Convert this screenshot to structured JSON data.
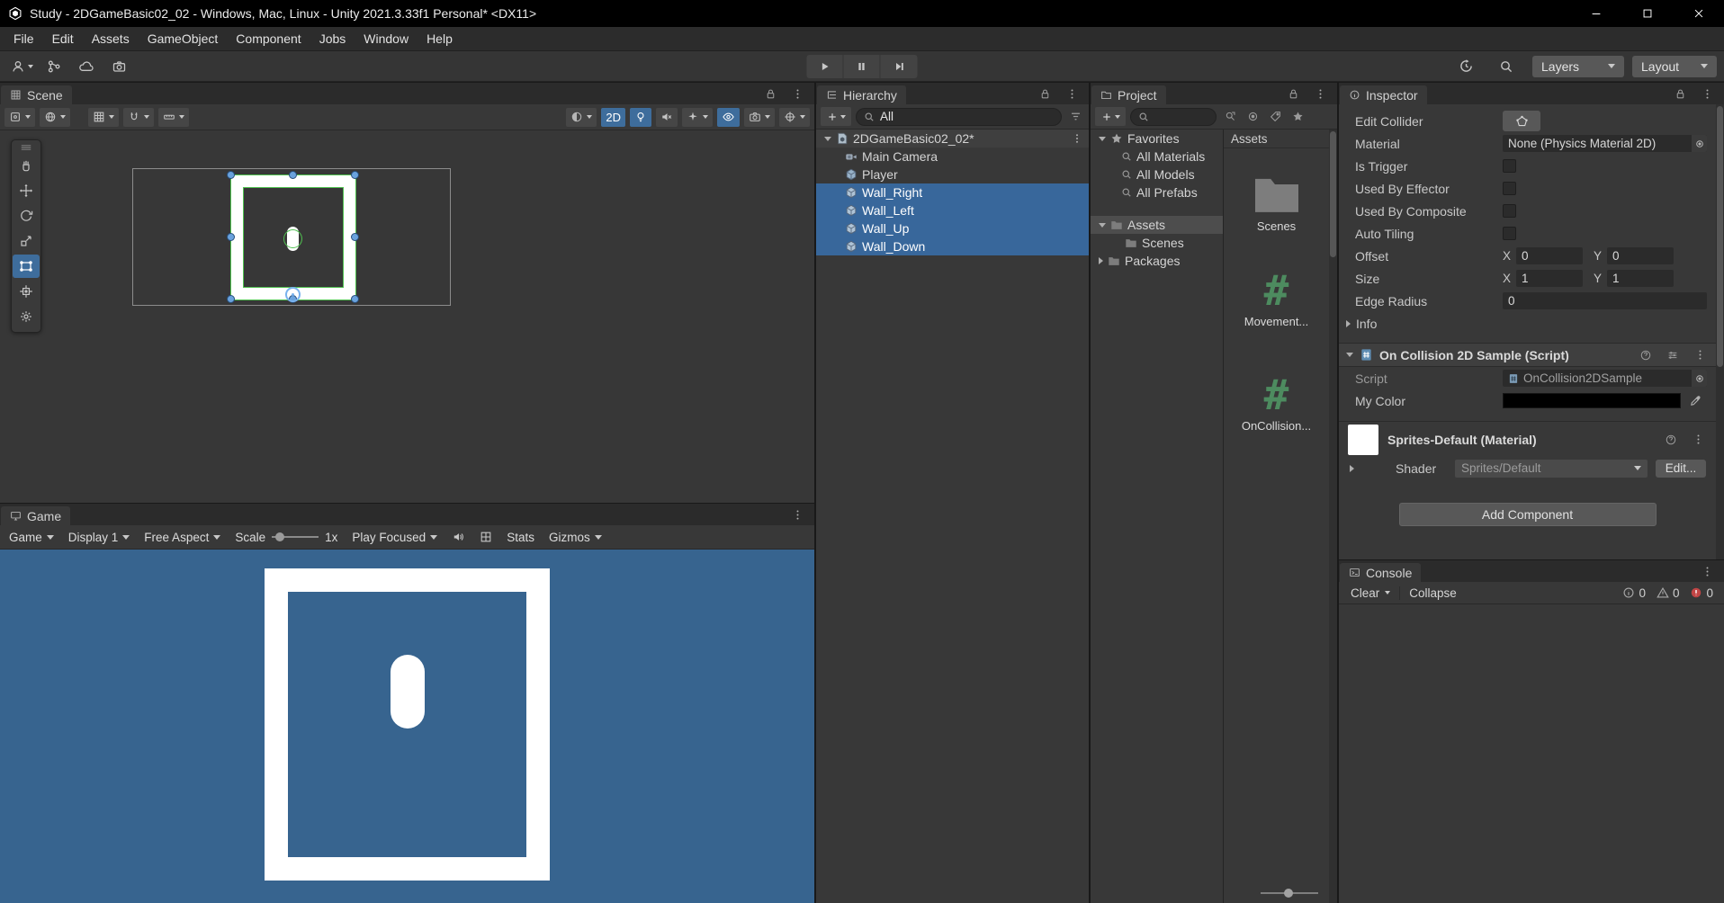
{
  "titlebar": {
    "title": "Study - 2DGameBasic02_02 - Windows, Mac, Linux - Unity 2021.3.33f1 Personal* <DX11>"
  },
  "menubar": {
    "items": [
      "File",
      "Edit",
      "Assets",
      "GameObject",
      "Component",
      "Jobs",
      "Window",
      "Help"
    ]
  },
  "toolbar": {
    "layers_label": "Layers",
    "layout_label": "Layout"
  },
  "scene_view": {
    "tab": "Scene",
    "toggle_2d": "2D"
  },
  "game_view": {
    "tab": "Game",
    "game_menu": "Game",
    "display": "Display 1",
    "aspect": "Free Aspect",
    "scale_label": "Scale",
    "scale_value": "1x",
    "focus_mode": "Play Focused",
    "stats_label": "Stats",
    "gizmos_label": "Gizmos"
  },
  "hierarchy": {
    "tab": "Hierarchy",
    "search_text": "All",
    "root": "2DGameBasic02_02*",
    "items": [
      {
        "label": "Main Camera",
        "selected": false
      },
      {
        "label": "Player",
        "selected": false
      },
      {
        "label": "Wall_Right",
        "selected": true
      },
      {
        "label": "Wall_Left",
        "selected": true
      },
      {
        "label": "Wall_Up",
        "selected": true
      },
      {
        "label": "Wall_Down",
        "selected": true
      }
    ]
  },
  "project": {
    "tab": "Project",
    "favorites": "Favorites",
    "favorite_items": [
      "All Materials",
      "All Models",
      "All Prefabs"
    ],
    "assets": "Assets",
    "assets_children": [
      "Scenes"
    ],
    "packages": "Packages",
    "grid_header": "Assets",
    "grid_items": [
      {
        "label": "Scenes",
        "type": "folder"
      },
      {
        "label": "Movement...",
        "type": "csharp-script"
      },
      {
        "label": "OnCollision...",
        "type": "csharp-script"
      }
    ]
  },
  "inspector": {
    "tab": "Inspector",
    "edit_collider": "Edit Collider",
    "material_label": "Material",
    "material_value": "None (Physics Material 2D)",
    "is_trigger": "Is Trigger",
    "used_by_effector": "Used By Effector",
    "used_by_composite": "Used By Composite",
    "auto_tiling": "Auto Tiling",
    "offset_label": "Offset",
    "size_label": "Size",
    "edge_radius_label": "Edge Radius",
    "x_label": "X",
    "y_label": "Y",
    "offset_x": "0",
    "offset_y": "0",
    "size_x": "1",
    "size_y": "1",
    "edge_radius_value": "0",
    "info_label": "Info",
    "script_component": {
      "title": "On Collision 2D Sample (Script)",
      "script_label": "Script",
      "script_value": "OnCollision2DSample",
      "my_color_label": "My Color"
    },
    "material_component": {
      "title": "Sprites-Default (Material)",
      "shader_label": "Shader",
      "shader_value": "Sprites/Default",
      "edit_button": "Edit..."
    },
    "add_component": "Add Component"
  },
  "console": {
    "tab": "Console",
    "clear": "Clear",
    "collapse": "Collapse",
    "info_count": "0",
    "warning_count": "0",
    "error_count": "0"
  },
  "icons": {
    "csharp_script": "#"
  },
  "colors": {
    "selection_blue": "#38679b",
    "unfocused_selection": "#4d4d4d",
    "game_background": "#37648f",
    "active_toggle": "#3e6d9c",
    "error_red": "#c14545",
    "gizmo_green": "#4fc14f"
  }
}
